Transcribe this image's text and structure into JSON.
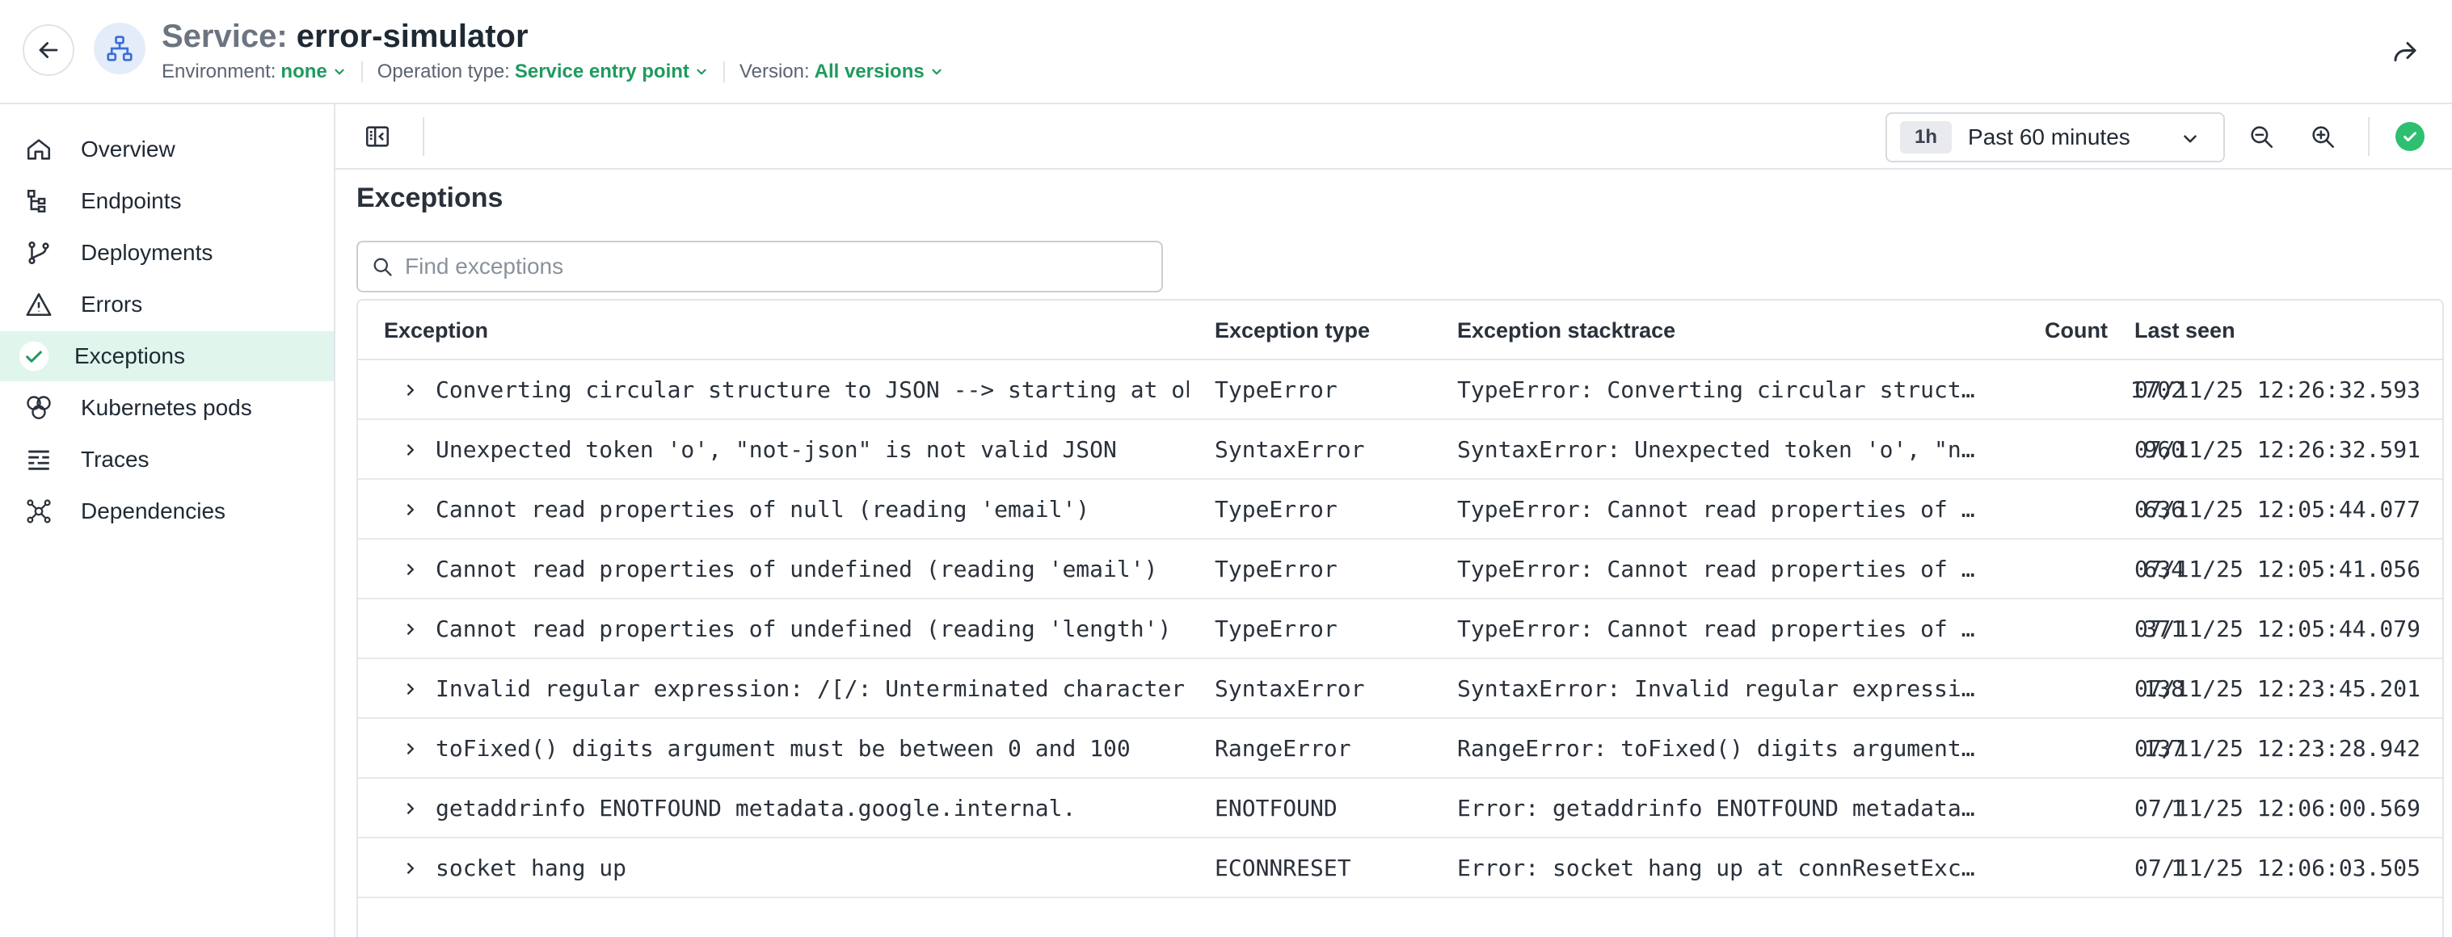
{
  "header": {
    "title_prefix": "Service:",
    "service_name": "error-simulator",
    "filters": [
      {
        "label": "Environment:",
        "value": "none"
      },
      {
        "label": "Operation type:",
        "value": "Service entry point"
      },
      {
        "label": "Version:",
        "value": "All versions"
      }
    ]
  },
  "sidebar": {
    "items": [
      {
        "label": "Overview",
        "icon": "home-icon"
      },
      {
        "label": "Endpoints",
        "icon": "endpoints-icon"
      },
      {
        "label": "Deployments",
        "icon": "branch-icon"
      },
      {
        "label": "Errors",
        "icon": "warning-icon"
      },
      {
        "label": "Exceptions",
        "icon": "check-icon",
        "active": true
      },
      {
        "label": "Kubernetes pods",
        "icon": "pods-icon"
      },
      {
        "label": "Traces",
        "icon": "traces-icon"
      },
      {
        "label": "Dependencies",
        "icon": "dependencies-icon"
      }
    ]
  },
  "toolbar": {
    "time_chip": "1h",
    "time_label": "Past 60 minutes"
  },
  "main": {
    "title": "Exceptions",
    "search_placeholder": "Find exceptions"
  },
  "table": {
    "columns": [
      "Exception",
      "Exception type",
      "Exception stacktrace",
      "Count",
      "Last seen"
    ],
    "rows": [
      {
        "exception": "Converting circular structure to JSON --> starting at object",
        "type": "TypeError",
        "stacktrace": "TypeError: Converting circular structure to JSON",
        "count": "1702",
        "last_seen": "07/11/25 12:26:32.593"
      },
      {
        "exception": "Unexpected token 'o', \"not-json\" is not valid JSON",
        "type": "SyntaxError",
        "stacktrace": "SyntaxError: Unexpected token 'o', \"not-json\"",
        "count": "960",
        "last_seen": "07/11/25 12:26:32.591"
      },
      {
        "exception": "Cannot read properties of null (reading 'email')",
        "type": "TypeError",
        "stacktrace": "TypeError: Cannot read properties of null",
        "count": "636",
        "last_seen": "07/11/25 12:05:44.077"
      },
      {
        "exception": "Cannot read properties of undefined (reading 'email')",
        "type": "TypeError",
        "stacktrace": "TypeError: Cannot read properties of undefined",
        "count": "634",
        "last_seen": "07/11/25 12:05:41.056"
      },
      {
        "exception": "Cannot read properties of undefined (reading 'length')",
        "type": "TypeError",
        "stacktrace": "TypeError: Cannot read properties of undefined",
        "count": "371",
        "last_seen": "07/11/25 12:05:44.079"
      },
      {
        "exception": "Invalid regular expression: /[/: Unterminated character",
        "type": "SyntaxError",
        "stacktrace": "SyntaxError: Invalid regular expression",
        "count": "138",
        "last_seen": "07/11/25 12:23:45.201"
      },
      {
        "exception": "toFixed() digits argument must be between 0 and 100",
        "type": "RangeError",
        "stacktrace": "RangeError: toFixed() digits argument must be",
        "count": "137",
        "last_seen": "07/11/25 12:23:28.942"
      },
      {
        "exception": "getaddrinfo ENOTFOUND metadata.google.internal.",
        "type": "ENOTFOUND",
        "stacktrace": "Error: getaddrinfo ENOTFOUND metadata.google.internal",
        "count": "1",
        "last_seen": "07/11/25 12:06:00.569"
      },
      {
        "exception": "socket hang up",
        "type": "ECONNRESET",
        "stacktrace": "Error: socket hang up at connResetException",
        "count": "1",
        "last_seen": "07/11/25 12:06:03.505"
      }
    ]
  },
  "colors": {
    "accent_green": "#1f9a5e",
    "active_bg": "#e0f5ec",
    "status_ok": "#2fbf71"
  }
}
